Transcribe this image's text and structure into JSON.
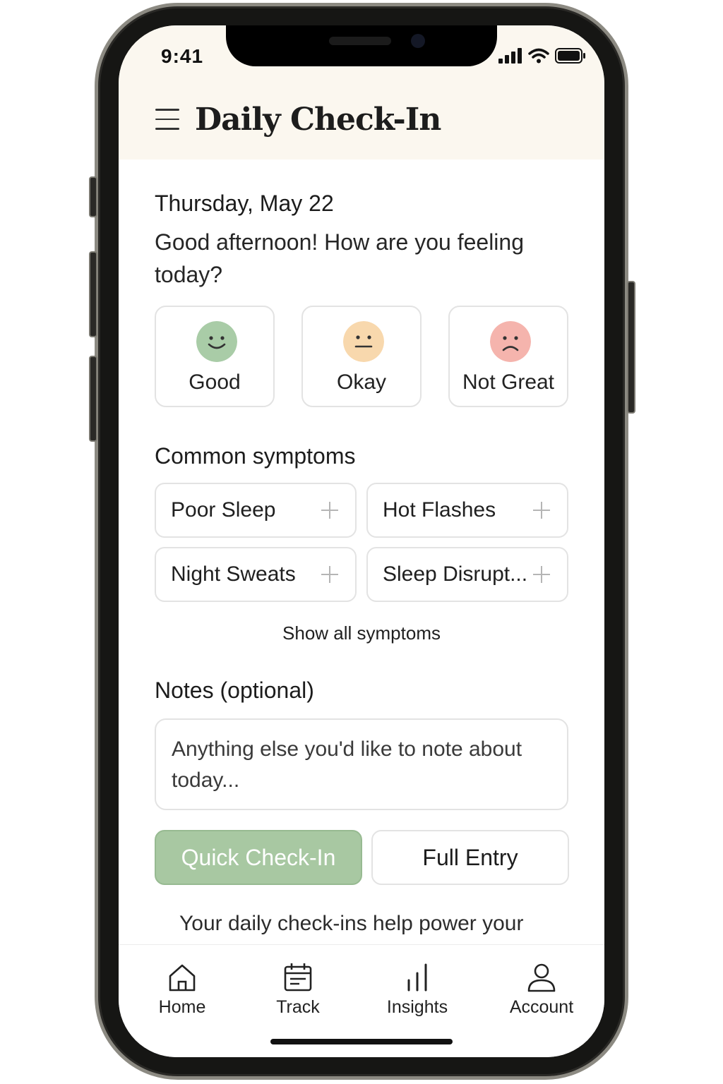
{
  "status_bar": {
    "time": "9:41"
  },
  "header": {
    "title": "Daily Check-In"
  },
  "date": "Thursday, May 22",
  "greeting": "Good afternoon! How are you feeling today?",
  "moods": [
    {
      "label": "Good",
      "color": "#a9cca7"
    },
    {
      "label": "Okay",
      "color": "#f8d8ad"
    },
    {
      "label": "Not Great",
      "color": "#f5b4ad"
    }
  ],
  "symptoms": {
    "title": "Common symptoms",
    "items": [
      "Poor Sleep",
      "Hot Flashes",
      "Night Sweats",
      "Sleep Disrupt..."
    ],
    "show_all": "Show all symptoms"
  },
  "notes": {
    "title": "Notes (optional)",
    "placeholder": "Anything else you'd like to note about today..."
  },
  "buttons": {
    "quick": "Quick Check-In",
    "full": "Full Entry"
  },
  "footer_note": "Your daily check-ins help power your personalized hormone insights.",
  "tabs": [
    {
      "label": "Home",
      "icon": "home-icon"
    },
    {
      "label": "Track",
      "icon": "calendar-icon"
    },
    {
      "label": "Insights",
      "icon": "bar-chart-icon"
    },
    {
      "label": "Account",
      "icon": "person-icon"
    }
  ],
  "colors": {
    "accent_green": "#a8c8a2",
    "header_bg": "#fbf7ef"
  }
}
